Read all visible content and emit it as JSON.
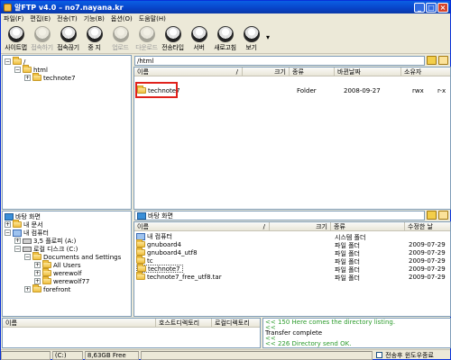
{
  "window": {
    "title": "알FTP v4.0 – no7.nayana.kr"
  },
  "window_controls": {
    "minimize": "_",
    "maximize": "□",
    "close": "×"
  },
  "menu": [
    "파일(F)",
    "편집(E)",
    "전송(T)",
    "기능(B)",
    "옵션(O)",
    "도움말(H)"
  ],
  "toolbar": [
    {
      "label": "사이트맵",
      "icon": "site-map-icon",
      "enabled": true
    },
    {
      "label": "접속하기",
      "icon": "connect-icon",
      "enabled": false
    },
    {
      "label": "접속끊기",
      "icon": "disconnect-icon",
      "enabled": true
    },
    {
      "label": "중 지",
      "icon": "stop-icon",
      "enabled": true
    },
    {
      "label": "업로드",
      "icon": "upload-icon",
      "enabled": false
    },
    {
      "label": "다운로드",
      "icon": "download-icon",
      "enabled": false
    },
    {
      "label": "전송타입",
      "icon": "transfer-type-icon",
      "enabled": true
    },
    {
      "label": "서버",
      "icon": "server-icon",
      "enabled": true
    },
    {
      "label": "새로고침",
      "icon": "refresh-icon",
      "enabled": true
    },
    {
      "label": "보기",
      "icon": "view-icon",
      "enabled": true
    }
  ],
  "toolbar_more": "▾",
  "remote_tree": {
    "root": "/",
    "html": "html",
    "child": "technote7"
  },
  "remote_path": "/html",
  "remote_columns": [
    "이름",
    "/",
    "크기",
    "종류",
    "바뀐날짜",
    "소유자"
  ],
  "remote_files": [
    {
      "name": "technote7",
      "type": "Folder",
      "date": "2008-09-27",
      "perm": "rwx",
      "extra": "r-x"
    }
  ],
  "local_tree": {
    "desktop": "바탕 화면",
    "mydocs": "내 문서",
    "mycomputer": "내 컴퓨터",
    "floppy": "3,5 플로피 (A:)",
    "localdisk": "로컬 디스크 (C:)",
    "docsettings": "Documents and Settings",
    "allusers": "All Users",
    "werewolf": "werewolf",
    "werewolf77": "werewolf77",
    "forefront": "forefront"
  },
  "local_path": "바탕 화면",
  "local_columns": [
    "이름",
    "/",
    "크기",
    "종류",
    "수정한 날"
  ],
  "local_files": [
    {
      "name": "내 컴퓨터",
      "type": "시스템 폴더",
      "date": "",
      "icon": "computer"
    },
    {
      "name": "gnuboard4",
      "type": "파일 폴더",
      "date": "2009-07-29",
      "icon": "folder"
    },
    {
      "name": "gnuboard4_utf8",
      "type": "파일 폴더",
      "date": "2009-07-29",
      "icon": "folder"
    },
    {
      "name": "tc",
      "type": "파일 폴더",
      "date": "2009-07-29",
      "icon": "folder"
    },
    {
      "name": "technote7",
      "type": "파일 폴더",
      "date": "2009-07-29",
      "icon": "folder"
    },
    {
      "name": "technote7_free_utf8.tar",
      "type": "파일 폴더",
      "date": "2009-07-29",
      "icon": "folder"
    }
  ],
  "queue_columns": [
    "이름",
    "호스트디렉토리",
    "로컬디렉토리"
  ],
  "log": [
    {
      "text": "<< 150 Here comes the directory listing.",
      "color": "green"
    },
    {
      "text": "<<",
      "color": "green"
    },
    {
      "text": "Transfer complete",
      "color": "black"
    },
    {
      "text": "<<",
      "color": "green"
    },
    {
      "text": "<< 226 Directory send OK.",
      "color": "green"
    },
    {
      "text": "<<",
      "color": "green"
    }
  ],
  "status": {
    "drive": "(C:)",
    "free": "8,63GB Free",
    "checkbox_label": "전송후 윈도우종료"
  }
}
